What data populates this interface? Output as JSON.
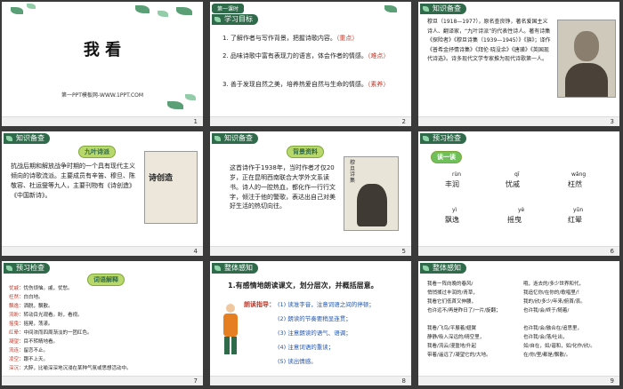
{
  "window": {
    "title": "我看 PPT 幻灯片浏览"
  },
  "slides": [
    {
      "num": "1",
      "title": "我 看",
      "site": "第一PPT模板网-WWW.1PPT.COM",
      "name": ""
    },
    {
      "num": "2",
      "tab": "第一课时",
      "header": "学习目标",
      "items": [
        {
          "text": "1. 了解作者与写作背景，把握诗歌内容。",
          "tag": "（重点）"
        },
        {
          "text": "2. 品味诗歌中富有表现力的语言，体会作者的情感。",
          "tag": "（难点）"
        },
        {
          "text": "3. 善于发现自然之美，培养热爱自然与生命的情感。",
          "tag": "（素养）"
        }
      ]
    },
    {
      "num": "3",
      "header": "知识备查",
      "text": "穆旦（1918—1977），原名查良铮，著名爱国主义诗人、翻译家，“九叶诗派”的代表性诗人。著有诗集《探险者》《穆旦诗集（1939—1945）》《旗》；译作《普希金抒情诗集》《拜伦·晓没余》《唐璜》《英国现代诗选》。诗多现代文学专家推为现代诗歌第一人。"
    },
    {
      "num": "4",
      "header": "知识备查",
      "badge": "九叶诗派",
      "text": "抗战后期和解放战争时期的一个具有现代主义倾向的诗歌流派。主要成员有辛笛、穆旦、陈敬容、杜运燮等九人，主要刊物有《诗创造》《中国新诗》。",
      "book": "诗创造"
    },
    {
      "num": "5",
      "header": "知识备查",
      "badge": "背景资料",
      "text": "这首诗作于1938年，当时作者才仅20岁，正在昆明西南联合大学外文系读书。诗人的一腔热血，都化作一行行文字，倾注于他的警歌，表达出自己对美好生活的热切向往。",
      "book": "穆旦诗集"
    },
    {
      "num": "6",
      "header": "预习检查",
      "badge": "读一读",
      "words": [
        {
          "py": "rùn",
          "w": "丰润"
        },
        {
          "py": "qī",
          "w": "忧戚"
        },
        {
          "py": "wǎng",
          "w": "枉然"
        },
        {
          "py": "yì",
          "w": "飘逸"
        },
        {
          "py": "yè",
          "w": "摇曳"
        },
        {
          "py": "yūn",
          "w": "红晕"
        }
      ]
    },
    {
      "num": "7",
      "header": "预习检查",
      "badge": "词语解释",
      "defs": [
        {
          "k": "忧戚：",
          "v": "忧伤烦恼。戚，忧愁。"
        },
        {
          "k": "枉然：",
          "v": "白白地。"
        },
        {
          "k": "飘逸：",
          "v": "洒脱，飘散。"
        },
        {
          "k": "流盼：",
          "v": "转动目光观看。盼，看视。"
        },
        {
          "k": "摇曳：",
          "v": "摇晃，荡漾。"
        },
        {
          "k": "红晕：",
          "v": "中间浓而四周渐淡的一团红色。"
        },
        {
          "k": "凝望：",
          "v": "目不转睛地看。"
        },
        {
          "k": "流连：",
          "v": "留恋不止。"
        },
        {
          "k": "凌空：",
          "v": "跟不上天。"
        },
        {
          "k": "深沉：",
          "v": "大醉，比喻深深地沉浸在某种气氛或思想活动中。"
        }
      ]
    },
    {
      "num": "8",
      "header": "整体感知",
      "task": "1.有感情地朗读课文，划分层次，并概括层意。",
      "tipLabel": "朗读指导：",
      "tips": [
        "(1) 读准字音，注意词语之间的停顿；",
        "(2) 朗读的节奏要稍显连贯；",
        "(3) 注意朗读的语气、语调；",
        "(4) 注意词语的重读；",
        "(5) 读出情感。"
      ]
    },
    {
      "num": "9",
      "header": "整体感知",
      "left": [
        "我看一阵向晚的春风/",
        "悄悄揉过丰润的/青草，",
        "我看它们低首又伸腰，",
        "也许远不/再是昨日了/一片/旋翻；",
        "我看/飞鸟/平展着/翅翼",
        "静静/吸入深远的/晴空里，",
        "我看/流云/漫盈地/升起",
        "带着/遥远了/凝望它的/大地。"
      ],
      "right": [
        "哦，逝去的/多少世界和代，",
        "我追忆你/在你的/歌唱里/！",
        "我的/欣/多少/年来/俯首/哀。",
        "也许我/会/终于/随着/",
        "也许我/会/融合在/追思里，",
        "也许我/会/落/吐出，",
        "如/自在，如/谐和，如/化作/欣/。",
        "在/你/里/都是/飘散/。"
      ]
    }
  ]
}
